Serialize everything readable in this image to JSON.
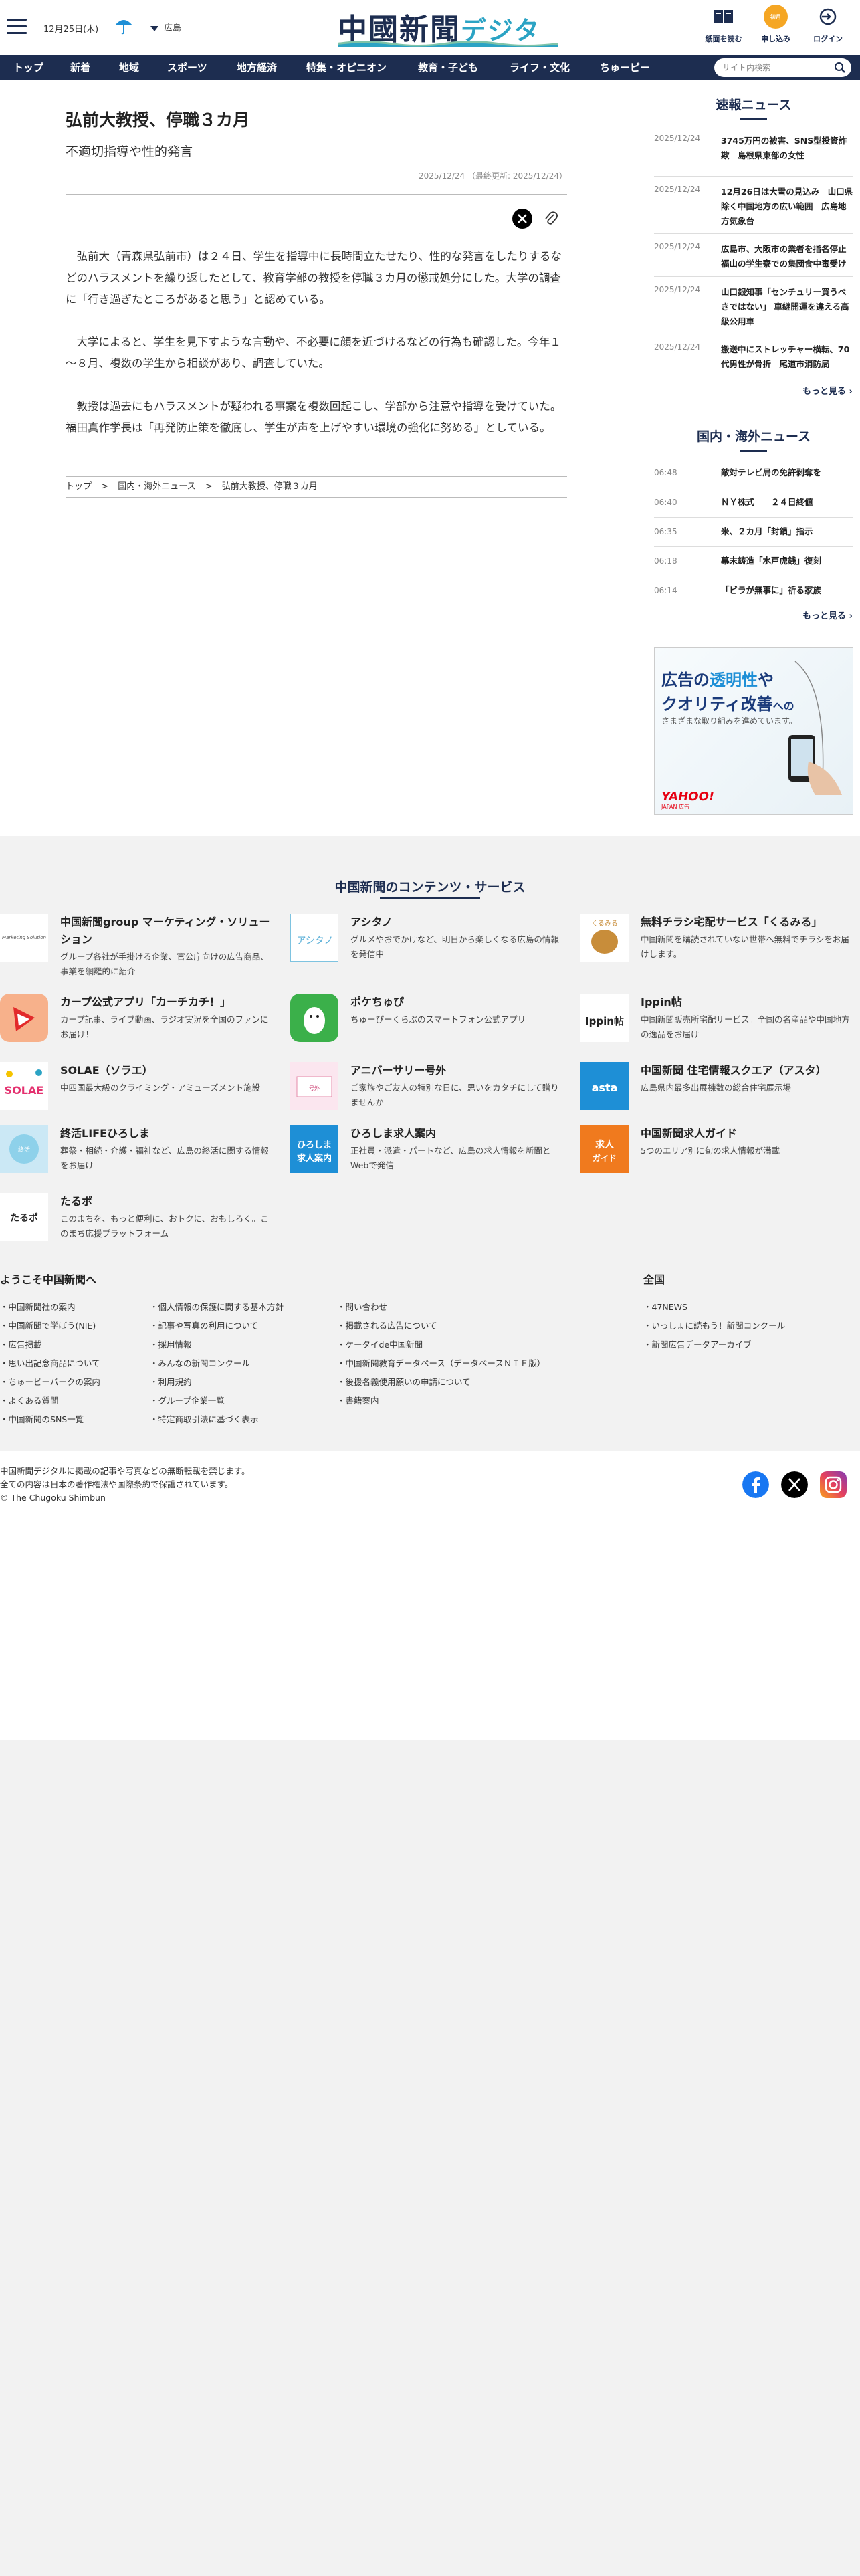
{
  "header": {
    "date": "12月25日(木)",
    "region": "広島",
    "logo_main": "中國新聞",
    "logo_sub": "デジタル",
    "buttons": [
      {
        "label": "紙面を読む",
        "icon": "newspaper-icon"
      },
      {
        "label": "申し込み",
        "icon": "signup-icon",
        "badge": "初月無料"
      },
      {
        "label": "ログイン",
        "icon": "login-icon"
      }
    ]
  },
  "nav": {
    "items": [
      "トップ",
      "新着",
      "地域",
      "スポーツ",
      "地方経済",
      "特集・オピニオン",
      "教育・子ども",
      "ライフ・文化",
      "ちゅーピー"
    ],
    "search_placeholder": "サイト内検索"
  },
  "article": {
    "title": "弘前大教授、停職３カ月",
    "subtitle": "不適切指導や性的発言",
    "date": "2025/12/24 （最終更新: 2025/12/24）",
    "paragraphs": [
      "弘前大（青森県弘前市）は２４日、学生を指導中に長時間立たせたり、性的な発言をしたりするなどのハラスメントを繰り返したとして、教育学部の教授を停職３カ月の懲戒処分にした。大学の調査に「行き過ぎたところがあると思う」と認めている。",
      "大学によると、学生を見下すような言動や、不必要に顔を近づけるなどの行為も確認した。今年１～８月、複数の学生から相談があり、調査していた。",
      "教授は過去にもハラスメントが疑われる事案を複数回起こし、学部から注意や指導を受けていた。福田真作学長は「再発防止策を徹底し、学生が声を上げやすい環境の強化に努める」としている。"
    ],
    "breadcrumb": [
      "トップ",
      "国内・海外ニュース",
      "弘前大教授、停職３カ月"
    ]
  },
  "breaking": {
    "heading": "速報ニュース",
    "items": [
      {
        "date": "2025/12/24",
        "title": "3745万円の被害、SNS型投資詐欺　島根県東部の女性"
      },
      {
        "date": "2025/12/24",
        "title": "12月26日は大雪の見込み　山口県除く中国地方の広い範囲　広島地方気象台"
      },
      {
        "date": "2025/12/24",
        "title": "広島市、大阪市の業者を指名停止　福山の学生寮での集団食中毒受け"
      },
      {
        "date": "2025/12/24",
        "title": "山口銀知事「センチュリー買うべきではない」 車継開運を違える高級公用車"
      },
      {
        "date": "2025/12/24",
        "title": "搬送中にストレッチャー横転、70代男性が骨折　尾道市消防局"
      }
    ],
    "more": "もっと見る"
  },
  "intl": {
    "heading": "国内・海外ニュース",
    "items": [
      {
        "date": "06:48",
        "title": "敵対テレビ局の免許剥奪を"
      },
      {
        "date": "06:40",
        "title": "ＮＹ株式　　２４日終値"
      },
      {
        "date": "06:35",
        "title": "米、２カ月「封鎖」指示"
      },
      {
        "date": "06:18",
        "title": "幕末鋳造「水戸虎銭」復刻"
      },
      {
        "date": "06:14",
        "title": "「ビラが無事に」祈る家族"
      }
    ],
    "more": "もっと見る"
  },
  "ad": {
    "line1_a": "広告の",
    "line1_b": "透明性",
    "line1_c": "や",
    "line2": "クオリティ改善",
    "line2_b": "への",
    "line3": "さまざまな取り組みを進めています。",
    "brand": "YAHOO!",
    "brand_sub": "JAPAN 広告"
  },
  "services": {
    "heading": "中国新聞のコンテンツ・サービス",
    "items": [
      {
        "title": "中国新聞group マーケティング・ソリューション",
        "desc": "グループ各社が手掛ける企業、官公庁向けの広告商品、事業を網羅的に紹介"
      },
      {
        "title": "アシタノ",
        "desc": "グルメやおでかけなど、明日から楽しくなる広島の情報を発信中"
      },
      {
        "title": "無料チラシ宅配サービス「くるみる」",
        "desc": "中国新聞を購読されていない世帯へ無料でチラシをお届けします。"
      },
      {
        "title": "カープ公式アプリ「カーチカチ！」",
        "desc": "カープ記事、ライブ動画、ラジオ実況を全国のファンにお届け！"
      },
      {
        "title": "ポケちゅぴ",
        "desc": "ちゅーぴーくらぶのスマートフォン公式アプリ"
      },
      {
        "title": "Ippin帖",
        "desc": "中国新聞販売所宅配サービス。全国の名産品や中国地方の逸品をお届け"
      },
      {
        "title": "SOLAE（ソラエ）",
        "desc": "中四国最大級のクライミング・アミューズメント施設"
      },
      {
        "title": "アニバーサリー号外",
        "desc": "ご家族やご友人の特別な日に、思いをカタチにして贈りませんか"
      },
      {
        "title": "中国新聞 住宅情報スクエア（アスタ）",
        "desc": "広島県内最多出展棟数の総合住宅展示場"
      },
      {
        "title": "終活LIFEひろしま",
        "desc": "葬祭・相続・介護・福祉など、広島の終活に関する情報をお届け"
      },
      {
        "title": "ひろしま求人案内",
        "desc": "正社員・派遣・パートなど、広島の求人情報を新聞とWebで発信"
      },
      {
        "title": "中国新聞求人ガイド",
        "desc": "5つのエリア別に旬の求人情報が満載"
      },
      {
        "title": "たるポ",
        "desc": "このまちを、もっと便利に、おトクに、おもしろく。このまち応援プラットフォーム"
      }
    ]
  },
  "welcome": {
    "heading": "ようこそ中国新聞へ",
    "col1": [
      "中国新聞社の案内",
      "中国新聞で学ぼう(NIE)",
      "広告掲載",
      "思い出記念商品について",
      "ちゅーピーパークの案内",
      "よくある質問",
      "中国新聞のSNS一覧"
    ],
    "col2": [
      "個人情報の保護に関する基本方針",
      "記事や写真の利用について",
      "採用情報",
      "みんなの新聞コンクール",
      "利用規約",
      "グループ企業一覧",
      "特定商取引法に基づく表示"
    ],
    "col3": [
      "問い合わせ",
      "掲載される広告について",
      "ケータイde中国新聞",
      "中国新聞教育データベース（データベースＮＩＥ版）",
      "後援名義使用願いの申請について",
      "書籍案内"
    ],
    "national_heading": "全国",
    "national": [
      "47NEWS",
      "いっしょに読もう！新聞コンクール",
      "新聞広告データアーカイブ"
    ]
  },
  "footer": {
    "lines": [
      "中国新聞デジタルに掲載の記事や写真などの無断転載を禁じます。",
      "全ての内容は日本の著作権法や国際条約で保護されています。",
      "© The Chugoku Shimbun"
    ]
  },
  "colors": {
    "navy": "#1d2d50",
    "accent": "#2ba3c4",
    "orange": "#f5a623"
  }
}
